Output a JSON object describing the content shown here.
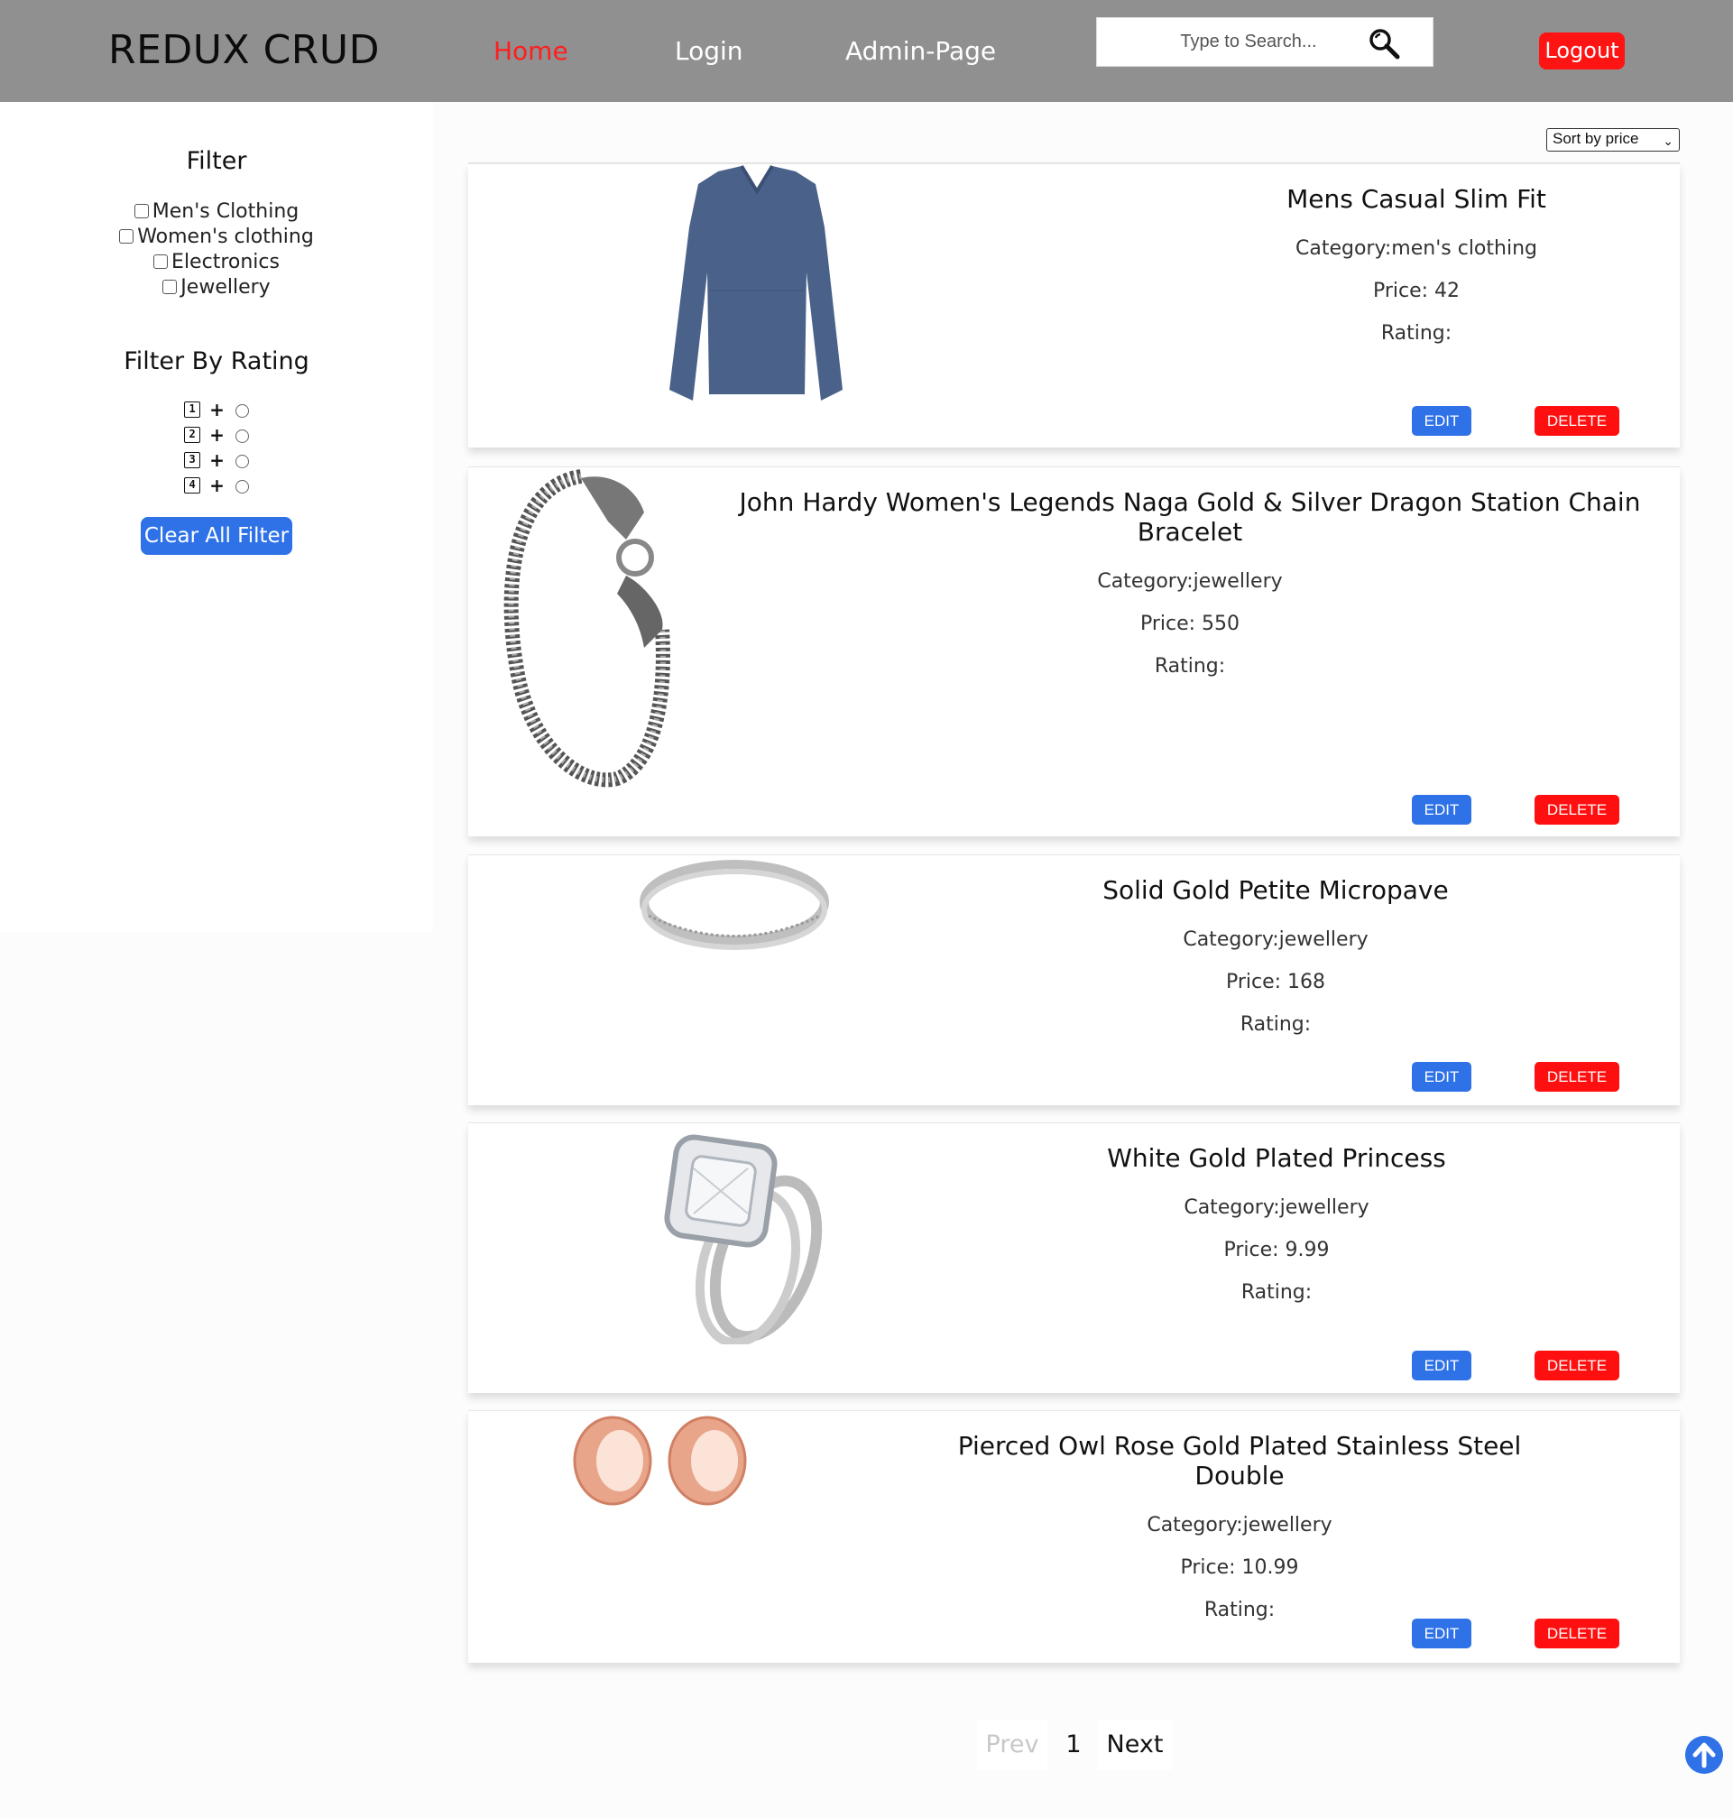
{
  "header": {
    "brand": "REDUX CRUD",
    "nav": [
      "Home",
      "Login",
      "Admin-Page"
    ],
    "search_placeholder": "Type to Search...",
    "logout": "Logout"
  },
  "sidebar": {
    "filter_title": "Filter",
    "categories": [
      "Men's Clothing",
      "Women's clothing",
      "Electronics",
      "Jewellery"
    ],
    "rating_title": "Filter By Rating",
    "ratings": [
      "1",
      "2",
      "3",
      "4"
    ],
    "plus": "+",
    "clear_label": "Clear All Filter"
  },
  "sort": {
    "selected": "Sort by price"
  },
  "products": [
    {
      "title": "Mens Casual Slim Fit",
      "category": "Category:men's clothing",
      "price": "Price: 42",
      "rating": "Rating:",
      "edit": "EDIT",
      "delete": "DELETE"
    },
    {
      "title": "John Hardy Women's Legends Naga Gold & Silver Dragon Station Chain Bracelet",
      "category": "Category:jewellery",
      "price": "Price: 550",
      "rating": "Rating:",
      "edit": "EDIT",
      "delete": "DELETE"
    },
    {
      "title": "Solid Gold Petite Micropave",
      "category": "Category:jewellery",
      "price": "Price: 168",
      "rating": "Rating:",
      "edit": "EDIT",
      "delete": "DELETE"
    },
    {
      "title": "White Gold Plated Princess",
      "category": "Category:jewellery",
      "price": "Price: 9.99",
      "rating": "Rating:",
      "edit": "EDIT",
      "delete": "DELETE"
    },
    {
      "title": "Pierced Owl Rose Gold Plated Stainless Steel Double",
      "category": "Category:jewellery",
      "price": "Price: 10.99",
      "rating": "Rating:",
      "edit": "EDIT",
      "delete": "DELETE"
    }
  ],
  "pagination": {
    "prev": "Prev",
    "current": "1",
    "next": "Next"
  },
  "colors": {
    "nav_bg": "#909090",
    "active": "#ff1e1e",
    "primary": "#2f72e8",
    "danger": "#ff0f0f"
  },
  "icons": {
    "search": "search-icon",
    "scroll_top": "arrow-up-circle-icon"
  }
}
